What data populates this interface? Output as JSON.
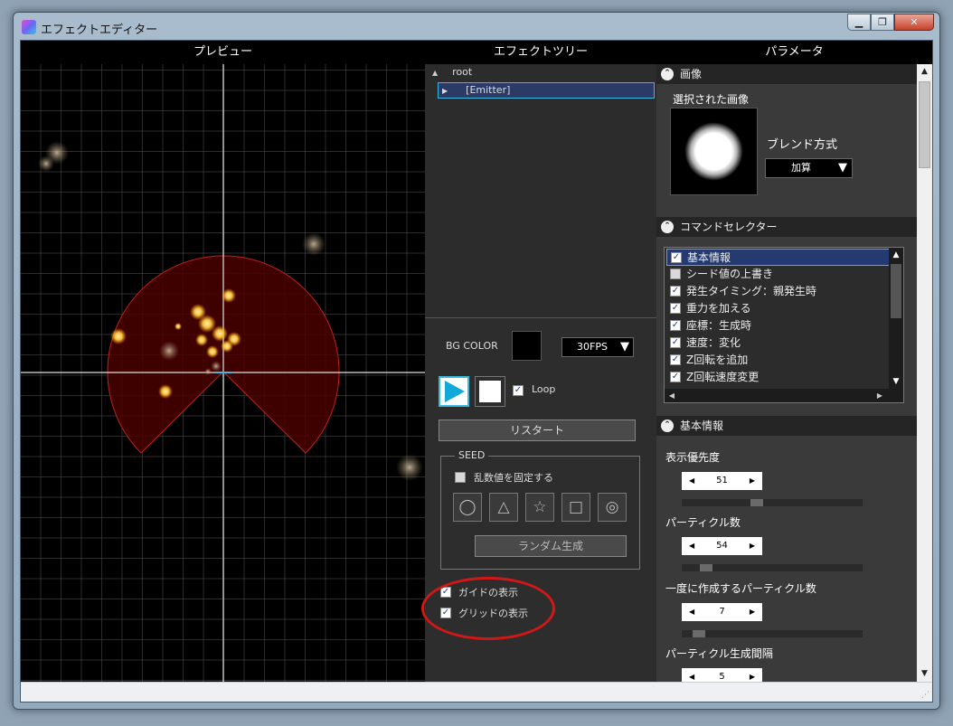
{
  "window": {
    "title": "エフェクトエディター",
    "min": "▁",
    "max": "❐",
    "close": "✕"
  },
  "headers": {
    "preview": "プレビュー",
    "tree": "エフェクトツリー",
    "params": "パラメータ"
  },
  "tree": {
    "root": {
      "label": "root",
      "icon": "▲"
    },
    "emitter": {
      "label": "[Emitter]",
      "icon": "▶"
    }
  },
  "controls": {
    "bg_color_label": "BG COLOR",
    "bg_color": "#000000",
    "fps": "30FPS",
    "loop_label": "Loop",
    "loop_checked": true,
    "restart_label": "リスタート",
    "seed": {
      "title": "SEED",
      "fix_random_label": "乱数値を固定する",
      "fix_random_checked": false,
      "symbols": [
        "◯",
        "△",
        "☆",
        "□",
        "◎"
      ],
      "random_gen_label": "ランダム生成"
    },
    "show_guide_label": "ガイドの表示",
    "show_guide_checked": true,
    "show_grid_label": "グリッドの表示",
    "show_grid_checked": true
  },
  "params": {
    "image_section": {
      "title": "画像",
      "selected_image_label": "選択された画像",
      "blend_label": "ブレンド方式",
      "blend_value": "加算"
    },
    "command_section": {
      "title": "コマンドセレクター",
      "items": [
        {
          "label": "基本情報",
          "checked": true,
          "selected": true
        },
        {
          "label": "シード値の上書き",
          "checked": false,
          "selected": false
        },
        {
          "label": "発生タイミング：親発生時",
          "checked": true,
          "selected": false
        },
        {
          "label": "重力を加える",
          "checked": true,
          "selected": false
        },
        {
          "label": "座標：生成時",
          "checked": true,
          "selected": false
        },
        {
          "label": "速度：変化",
          "checked": true,
          "selected": false
        },
        {
          "label": "Z回転を追加",
          "checked": true,
          "selected": false
        },
        {
          "label": "Z回転速度変更",
          "checked": true,
          "selected": false
        }
      ]
    },
    "basic_section": {
      "title": "基本情報",
      "fields": [
        {
          "label": "表示優先度",
          "value": "51",
          "level": 0.38
        },
        {
          "label": "パーティクル数",
          "value": "54",
          "level": 0.1
        },
        {
          "label": "一度に作成するパーティクル数",
          "value": "7",
          "level": 0.06
        },
        {
          "label": "パーティクル生成間隔",
          "value": "5",
          "level": 0.05
        }
      ]
    }
  },
  "colors": {
    "emitter_fill": "#4a0000",
    "particle": "#ffc840",
    "guide": "#e0e0e0",
    "accent": "#3ab8e0",
    "highlight": "#d01818"
  }
}
